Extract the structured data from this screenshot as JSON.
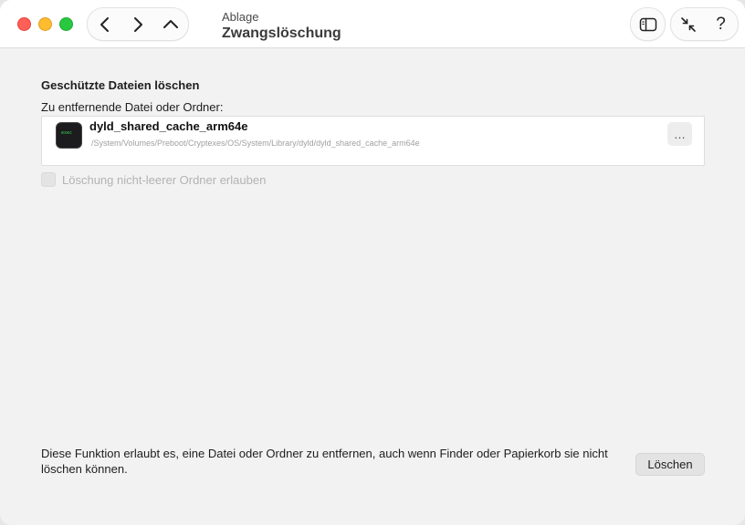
{
  "titlebar": {
    "breadcrumb": "Ablage",
    "title": "Zwangslöschung",
    "nav_icons": [
      "chevron-left-icon",
      "chevron-right-icon",
      "chevron-up-icon"
    ],
    "right_icons": [
      "sidebar-icon",
      "collapse-arrows-icon",
      "help-icon"
    ],
    "help_glyph": "?"
  },
  "main": {
    "section_title": "Geschützte Dateien löschen",
    "field_label": "Zu entfernende Datei oder Ordner:",
    "file": {
      "name": "dyld_shared_cache_arm64e",
      "path": "/System/Volumes/Preboot/Cryptexes/OS/System/Library/dyld/dyld_shared_cache_arm64e",
      "icon": "terminal-exec-icon",
      "icon_text": "exec"
    },
    "more_button_label": "…",
    "checkbox_label": "Löschung nicht-leerer Ordner erlauben",
    "checkbox_checked": false,
    "checkbox_enabled": false
  },
  "footer": {
    "description": "Diese Funktion erlaubt es, eine Datei oder Ordner zu entfernen, auch wenn Finder oder Papierkorb sie nicht löschen können.",
    "delete_button_label": "Löschen"
  },
  "colors": {
    "close": "#fe5f57",
    "minimize": "#febc2e",
    "maximize": "#28c840",
    "window_bg": "#f2f2f2"
  }
}
